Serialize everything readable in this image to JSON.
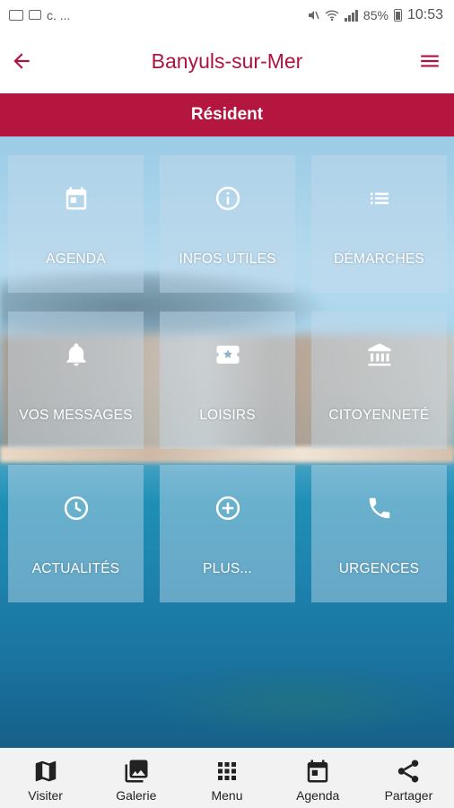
{
  "status_bar": {
    "left_text": "c. ...",
    "battery": "85%",
    "time": "10:53"
  },
  "app_bar": {
    "title": "Banyuls-sur-Mer",
    "back_icon": "arrow-back-icon",
    "menu_icon": "hamburger-menu-icon"
  },
  "banner": {
    "label": "Résident"
  },
  "tiles": [
    {
      "label": "AGENDA",
      "icon": "calendar-icon"
    },
    {
      "label": "INFOS UTILES",
      "icon": "info-icon"
    },
    {
      "label": "DÉMARCHES",
      "icon": "list-icon"
    },
    {
      "label": "VOS MESSAGES",
      "icon": "bell-icon"
    },
    {
      "label": "LOISIRS",
      "icon": "ticket-star-icon"
    },
    {
      "label": "CITOYENNETÉ",
      "icon": "institution-icon"
    },
    {
      "label": "ACTUALITÉS",
      "icon": "clock-icon"
    },
    {
      "label": "PLUS...",
      "icon": "plus-circle-icon"
    },
    {
      "label": "URGENCES",
      "icon": "phone-icon"
    }
  ],
  "bottom_nav": [
    {
      "label": "Visiter",
      "icon": "map-icon"
    },
    {
      "label": "Galerie",
      "icon": "gallery-icon"
    },
    {
      "label": "Menu",
      "icon": "grid-icon"
    },
    {
      "label": "Agenda",
      "icon": "calendar-icon"
    },
    {
      "label": "Partager",
      "icon": "share-icon"
    }
  ],
  "colors": {
    "accent": "#b5163f",
    "title": "#b0123f",
    "nav_bg": "#f2f2f2"
  }
}
